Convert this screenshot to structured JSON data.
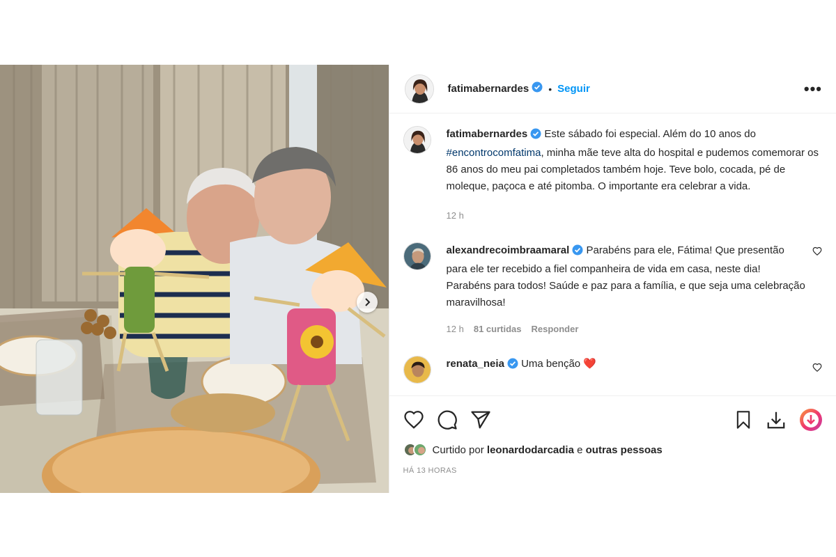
{
  "post": {
    "author": "fatimabernardes",
    "follow_label": "Seguir",
    "separator": "•",
    "more_label": "•••"
  },
  "caption": {
    "username": "fatimabernardes",
    "text_before": "Este sábado foi especial. Além do 10 anos do ",
    "hashtag": "#encontrocomfatima",
    "text_after": ", minha mãe teve alta do hospital e pudemos comemorar os 86 anos do meu pai completados também hoje. Teve bolo, cocada, pé de moleque, paçoca e até pitomba. O importante era celebrar a vida.",
    "time": "12 h"
  },
  "comments": [
    {
      "username": "alexandrecoimbraamaral",
      "text": "Parabéns para ele, Fátima! Que presentão para ele ter recebido a fiel companheira de vida em casa, neste dia! Parabéns para todos! Saúde e paz para a família, e que seja uma celebração maravilhosa!",
      "time": "12 h",
      "likes": "81 curtidas",
      "reply": "Responder"
    },
    {
      "username": "renata_neia",
      "text": "Uma benção",
      "emoji": "❤️"
    }
  ],
  "likes_line": {
    "prefix": "Curtido por",
    "user": "leonardodarcadia",
    "connector": "e",
    "others": "outras pessoas"
  },
  "timestamp": "HÁ 13 HORAS",
  "colors": {
    "link_blue": "#0095f6",
    "verified_blue": "#3897f0",
    "hashtag": "#00376b",
    "muted": "#8e8e8e"
  },
  "icons": [
    "verified-icon",
    "heart-icon",
    "comment-icon",
    "share-icon",
    "bookmark-icon",
    "download-icon",
    "save-extension-icon",
    "chevron-right-icon",
    "more-options-icon"
  ]
}
